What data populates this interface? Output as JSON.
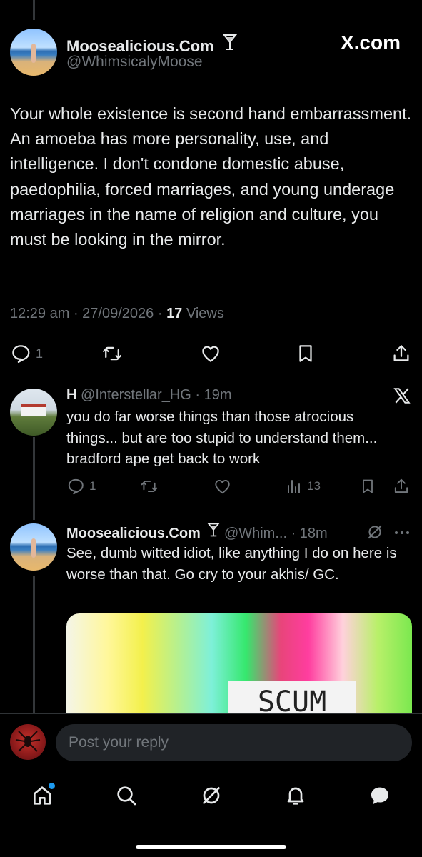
{
  "main_tweet": {
    "display_name": "Moosealicious.Com",
    "handle": "@WhimsicalyMoose",
    "watermark": "X.com",
    "body": "Your whole existence is second hand embarrassment. An amoeba has more personality, use, and intelligence. I don't condone domestic abuse, paedophilia, forced marriages, and young underage marriages in the name of religion and culture, you must be looking in the mirror.",
    "time": "12:29 am",
    "date": "27/09/2026",
    "views_count": "17",
    "views_label": "Views",
    "reply_count": "1"
  },
  "reply_1": {
    "display_name": "H",
    "handle": "@Interstellar_HG",
    "time": "19m",
    "body": "you do far worse things than those atrocious things... but are too stupid to understand them... bradford ape get back to work",
    "reply_count": "1",
    "views_count": "13"
  },
  "reply_2": {
    "display_name": "Moosealicious.Com",
    "handle": "@Whim...",
    "time": "18m",
    "body": "See, dumb witted idiot, like anything I do on here is worse than that. Go cry to your akhis/ GC.",
    "media_text": "SCUM"
  },
  "composer": {
    "placeholder": "Post your reply"
  },
  "colors": {
    "accent": "#1d9bf0",
    "muted": "#71767b",
    "divider": "#2f3336"
  },
  "icons": {
    "tabs": [
      "home-icon",
      "search-icon",
      "grok-icon",
      "notifications-icon",
      "messages-icon"
    ]
  }
}
